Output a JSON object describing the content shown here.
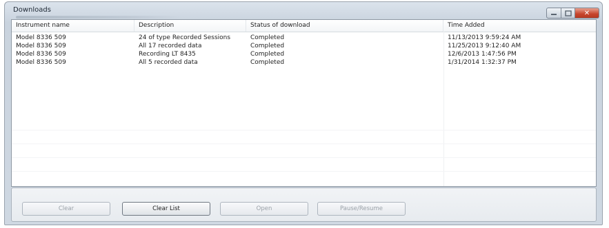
{
  "window": {
    "title": "Downloads",
    "controls": {
      "minimize_icon": "minimize-icon",
      "maximize_icon": "maximize-icon",
      "close_icon": "close-icon",
      "close_glyph": "✕"
    }
  },
  "table": {
    "columns": [
      "Instrument name",
      "Description",
      "Status of download",
      "Time Added"
    ],
    "rows": [
      [
        "Model 8336 509",
        "24 of type Recorded Sessions",
        "Completed",
        "11/13/2013 9:59:24 AM"
      ],
      [
        "Model 8336 509",
        "All 17 recorded data",
        "Completed",
        "11/25/2013 9:12:40 AM"
      ],
      [
        "Model 8336 509",
        "Recording LT 8435",
        "Completed",
        "12/6/2013 1:47:56 PM"
      ],
      [
        "Model 8336 509",
        "All 5 recorded data",
        "Completed",
        "1/31/2014 1:32:37 PM"
      ]
    ]
  },
  "buttons": {
    "clear": "Clear",
    "clear_list": "Clear List",
    "open": "Open",
    "pause_resume": "Pause/Resume"
  }
}
